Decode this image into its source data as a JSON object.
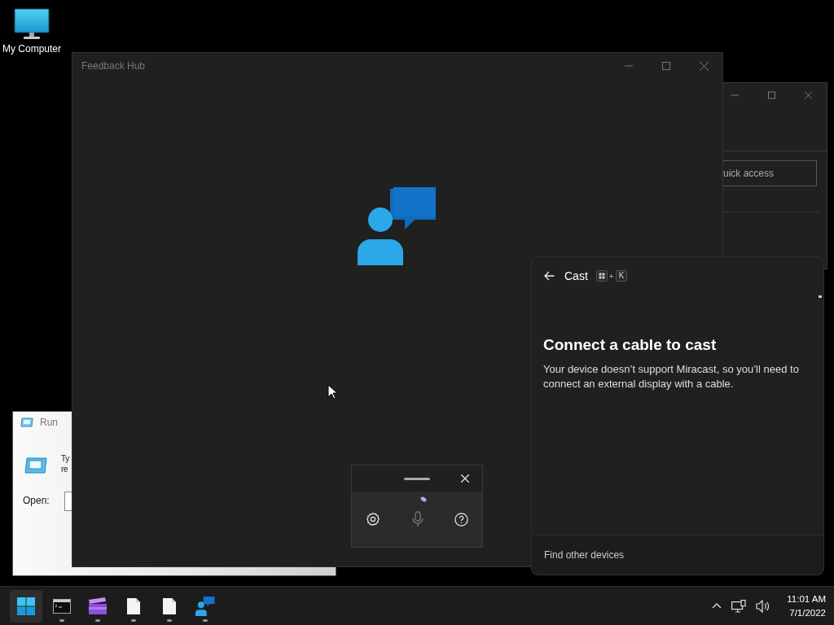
{
  "desktop": {
    "icons": [
      {
        "label": "My Computer"
      }
    ]
  },
  "explorer_window": {
    "search_field": {
      "value": "uick access"
    }
  },
  "feedback_hub": {
    "title": "Feedback Hub"
  },
  "run_dialog": {
    "title": "Run",
    "description_lines": [
      "Ty",
      "re"
    ],
    "open_label": "Open:"
  },
  "voice_typing": {
    "listening": true
  },
  "cast_panel": {
    "title": "Cast",
    "shortcut": {
      "joiner": "+",
      "key": "K"
    },
    "heading": "Connect a cable to cast",
    "message": "Your device doesn’t support Miracast, so you’ll need to connect an external display with a cable.",
    "footer_link": "Find other devices"
  },
  "taskbar": {
    "apps": [
      {
        "kind": "start",
        "selected": true,
        "running": false
      },
      {
        "kind": "terminal",
        "selected": false,
        "running": true
      },
      {
        "kind": "video",
        "selected": false,
        "running": true
      },
      {
        "kind": "document",
        "selected": false,
        "running": true
      },
      {
        "kind": "document",
        "selected": false,
        "running": true
      },
      {
        "kind": "feedback",
        "selected": false,
        "running": true
      }
    ],
    "clock": {
      "time": "11:01 AM",
      "date": "7/1/2022"
    }
  }
}
